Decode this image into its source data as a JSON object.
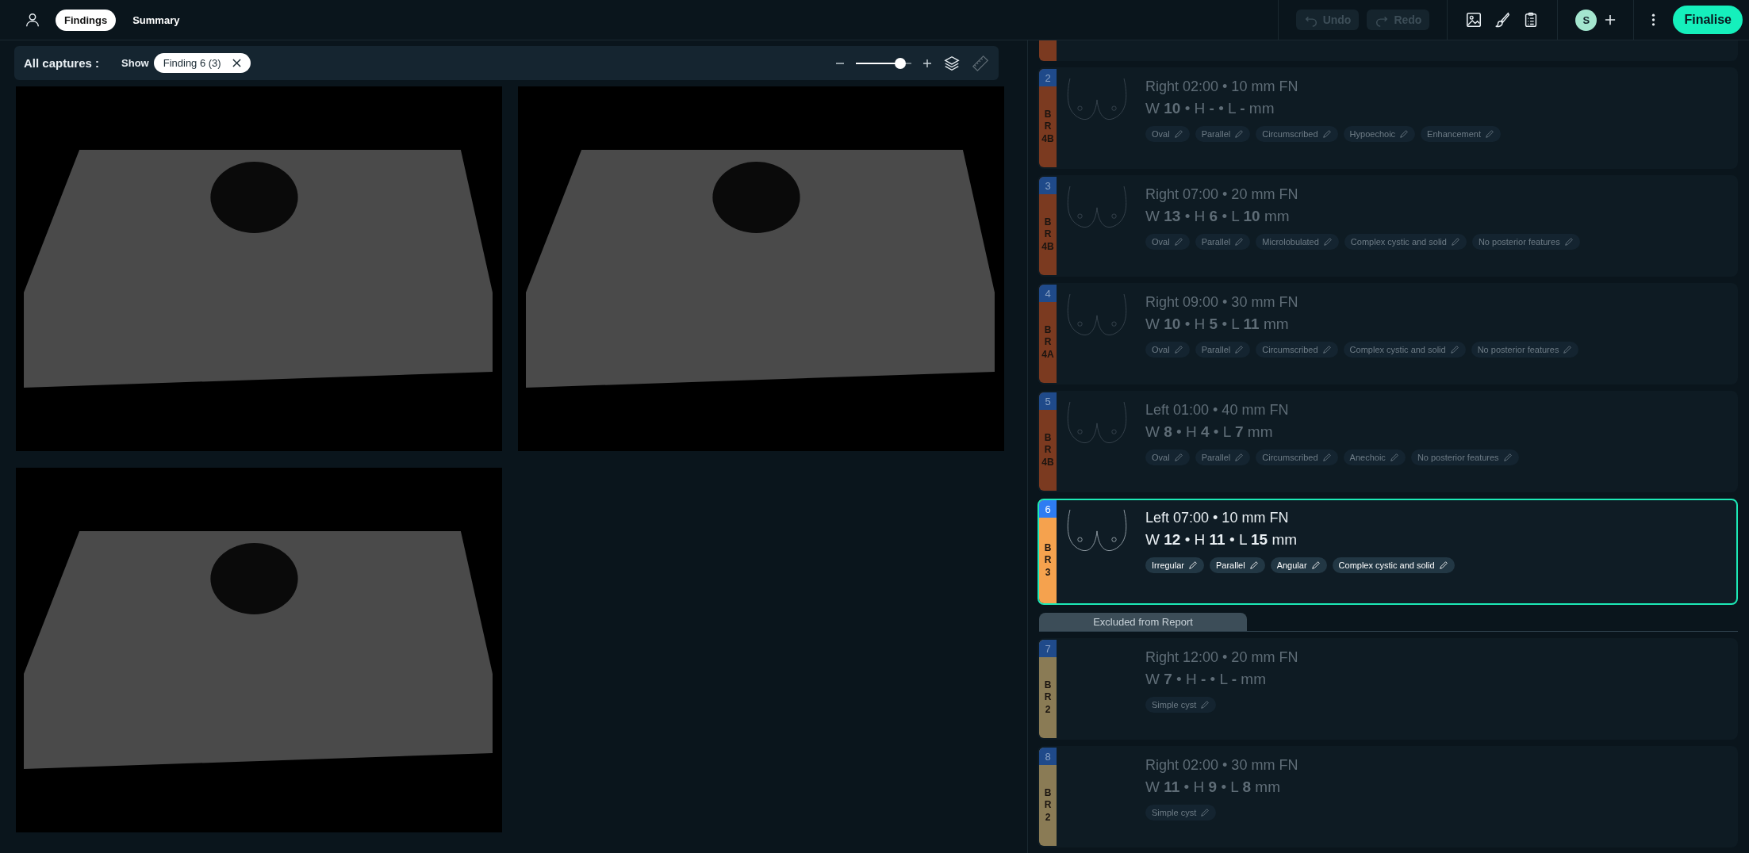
{
  "header": {
    "tabs": [
      {
        "label": "Findings",
        "selected": true
      },
      {
        "label": "Summary",
        "selected": false
      }
    ],
    "undo": {
      "label": "Undo",
      "disabled": true
    },
    "redo": {
      "label": "Redo",
      "disabled": true
    },
    "avatar": {
      "initial": "S"
    },
    "finalise": "Finalise"
  },
  "captures_bar": {
    "title": "All captures :",
    "show_label": "Show",
    "filter_chip": "Finding 6 (3)",
    "zoom": {
      "level": 0.8
    },
    "measure_disabled": true
  },
  "findings": [
    {
      "number": "2",
      "birads": [
        "B",
        "R",
        "4B"
      ],
      "color": "#7b3a20",
      "title": "Right 02:00 • 10 mm FN",
      "dims": "W **10** • H **-** • L **-** mm",
      "tags": [
        "Oval",
        "Parallel",
        "Circumscribed",
        "Hypoechoic",
        "Enhancement"
      ],
      "diagram": true,
      "selected": false
    },
    {
      "number": "3",
      "birads": [
        "B",
        "R",
        "4B"
      ],
      "color": "#7b3a20",
      "title": "Right 07:00 • 20 mm FN",
      "dims": "W **13** • H **6** • L **10** mm",
      "tags": [
        "Oval",
        "Parallel",
        "Microlobulated",
        "Complex cystic and solid",
        "No posterior features"
      ],
      "diagram": true,
      "selected": false
    },
    {
      "number": "4",
      "birads": [
        "B",
        "R",
        "4A"
      ],
      "color": "#7b3a20",
      "title": "Right 09:00 • 30 mm FN",
      "dims": "W **10** • H **5** • L **11** mm",
      "tags": [
        "Oval",
        "Parallel",
        "Circumscribed",
        "Complex cystic and solid",
        "No posterior features"
      ],
      "diagram": true,
      "selected": false
    },
    {
      "number": "5",
      "birads": [
        "B",
        "R",
        "4B"
      ],
      "color": "#7b3a20",
      "title": "Left 01:00 • 40 mm FN",
      "dims": "W **8** • H **4** • L **7** mm",
      "tags": [
        "Oval",
        "Parallel",
        "Circumscribed",
        "Anechoic",
        "No posterior features"
      ],
      "diagram": true,
      "selected": false
    },
    {
      "number": "6",
      "birads": [
        "B",
        "R",
        "3"
      ],
      "color": "#f5a24e",
      "title": "Left 07:00 • 10 mm FN",
      "dims": "W **12** • H **11** • L **15** mm",
      "tags": [
        "Irregular",
        "Parallel",
        "Angular",
        "Complex cystic and solid"
      ],
      "diagram": true,
      "selected": true
    }
  ],
  "excluded_label": "Excluded from Report",
  "excluded_findings": [
    {
      "number": "7",
      "birads": [
        "B",
        "R",
        "2"
      ],
      "color": "#8a7b55",
      "title": "Right 12:00 • 20 mm FN",
      "dims": "W **7** • H **-** • L **-** mm",
      "tags": [
        "Simple cyst"
      ],
      "diagram": false,
      "selected": false
    },
    {
      "number": "8",
      "birads": [
        "B",
        "R",
        "2"
      ],
      "color": "#8a7b55",
      "title": "Right 02:00 • 30 mm FN",
      "dims": "W **11** • H **9** • L **8** mm",
      "tags": [
        "Simple cyst"
      ],
      "diagram": false,
      "selected": false
    }
  ]
}
